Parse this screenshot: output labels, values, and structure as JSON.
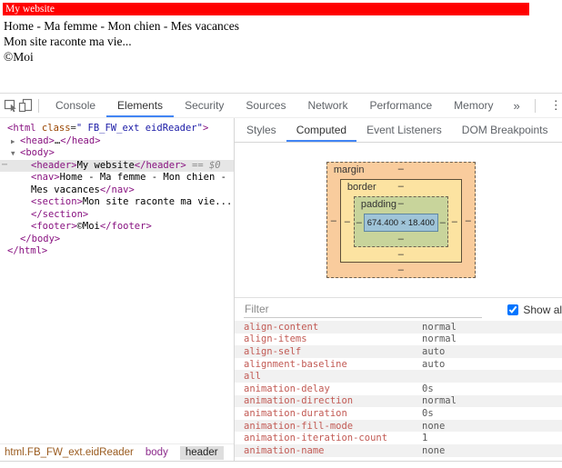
{
  "webpage": {
    "header_text": "My website",
    "header_bg_color": "#ff0000",
    "header_text_color": "#ffffff",
    "nav_text": "Home - Ma femme - Mon chien - Mes vacances",
    "section_text": "Mon site raconte ma vie...",
    "footer_text": "©Moi"
  },
  "devtools": {
    "toolbar": {
      "tabs": [
        "Console",
        "Elements",
        "Security",
        "Sources",
        "Network",
        "Performance",
        "Memory"
      ],
      "active_tab": "Elements",
      "overflow_icon": "»",
      "menu_icon": "⋮",
      "close_icon": "✕",
      "accent_color": "#4285f4"
    },
    "dom_tree": {
      "gutter_dots": "⋯",
      "colors": {
        "tag": "#881280",
        "attribute_name": "#994500",
        "attribute_value": "#1a1aa6",
        "selected_row_bg": "#e6e6e6"
      },
      "lines": {
        "html_open": {
          "tag_open": "<html",
          "attr_name": " class",
          "equals": "=",
          "attr_value": "\" FB_FW_ext eidReader\"",
          "tag_close": ">"
        },
        "head": {
          "arrow": "▶",
          "open_tag": "<head>",
          "ellipsis": "…",
          "close_tag": "</head>"
        },
        "body_open": {
          "arrow": "▼",
          "open_tag": "<body>"
        },
        "header": {
          "open_tag": "<header>",
          "text": "My website",
          "close_tag": "</header>",
          "suffix": " == $0"
        },
        "nav_line1": {
          "open_tag": "<nav>",
          "text": "Home - Ma femme - Mon chien -"
        },
        "nav_line2": {
          "text": "Mes vacances",
          "close_tag": "</nav>"
        },
        "section_line1": {
          "open_tag": "<section>",
          "text": "Mon site raconte ma vie..."
        },
        "section_line2": {
          "close_tag": "</section>"
        },
        "footer": {
          "open_tag": "<footer>",
          "text": "©Moi",
          "close_tag": "</footer>"
        },
        "body_close": {
          "close_tag": "</body>"
        },
        "html_close": {
          "close_tag": "</html>"
        }
      }
    },
    "sidebar": {
      "tabs": [
        "Styles",
        "Computed",
        "Event Listeners",
        "DOM Breakpoints"
      ],
      "active_tab": "Computed",
      "overflow_icon": "»",
      "box_model": {
        "margin_label": "margin",
        "border_label": "border",
        "padding_label": "padding",
        "content_size": "674.400 × 18.400",
        "value_placeholder": "–",
        "colors": {
          "margin": "#f9cc9d",
          "border": "#fce3a1",
          "padding": "#c8d49b",
          "content": "#9fc4d8"
        }
      },
      "filter": {
        "placeholder": "Filter",
        "show_all_label": "Show all",
        "show_all_checked": "true"
      },
      "scrollbar": {
        "up_icon": "▲",
        "down_icon": "▼"
      },
      "properties": [
        {
          "name": "align-content",
          "value": "normal"
        },
        {
          "name": "align-items",
          "value": "normal"
        },
        {
          "name": "align-self",
          "value": "auto"
        },
        {
          "name": "alignment-baseline",
          "value": "auto"
        },
        {
          "name": "all",
          "value": ""
        },
        {
          "name": "animation-delay",
          "value": "0s"
        },
        {
          "name": "animation-direction",
          "value": "normal"
        },
        {
          "name": "animation-duration",
          "value": "0s"
        },
        {
          "name": "animation-fill-mode",
          "value": "none"
        },
        {
          "name": "animation-iteration-count",
          "value": "1"
        },
        {
          "name": "animation-name",
          "value": "none"
        }
      ]
    },
    "breadcrumbs": [
      {
        "label": "html.FB_FW_ext.eidReader"
      },
      {
        "label": "body"
      },
      {
        "label": "header"
      }
    ]
  }
}
